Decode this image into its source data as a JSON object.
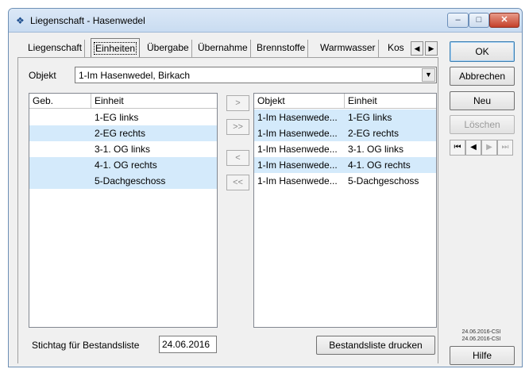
{
  "window": {
    "title": "Liegenschaft - Hasenwedel",
    "controls": {
      "minimize": "–",
      "maximize": "□",
      "close": "✕"
    }
  },
  "tabs": [
    {
      "label": "Liegenschaft",
      "active": false
    },
    {
      "label": "Einheiten",
      "active": true
    },
    {
      "label": "Übergabe",
      "active": false
    },
    {
      "label": "Übernahme",
      "active": false
    },
    {
      "label": "Brennstoffe",
      "active": false
    },
    {
      "label": "Warmwasser",
      "active": false
    },
    {
      "label": "Kos",
      "active": false
    }
  ],
  "objekt": {
    "label": "Objekt",
    "value": "1-Im Hasenwedel, Birkach"
  },
  "left_list": {
    "columns": [
      "Geb.",
      "Einheit"
    ],
    "rows": [
      {
        "geb": "",
        "einheit": "1-EG links"
      },
      {
        "geb": "",
        "einheit": "2-EG rechts"
      },
      {
        "geb": "",
        "einheit": "3-1. OG links"
      },
      {
        "geb": "",
        "einheit": "4-1. OG rechts"
      },
      {
        "geb": "",
        "einheit": "5-Dachgeschoss"
      }
    ]
  },
  "move_buttons": [
    ">",
    ">>",
    "<",
    "<<"
  ],
  "right_list": {
    "columns": [
      "Objekt",
      "Einheit"
    ],
    "rows": [
      {
        "objekt": "1-Im Hasenwede...",
        "einheit": "1-EG links"
      },
      {
        "objekt": "1-Im Hasenwede...",
        "einheit": "2-EG rechts"
      },
      {
        "objekt": "1-Im Hasenwede...",
        "einheit": "3-1. OG links"
      },
      {
        "objekt": "1-Im Hasenwede...",
        "einheit": "4-1. OG rechts"
      },
      {
        "objekt": "1-Im Hasenwede...",
        "einheit": "5-Dachgeschoss"
      }
    ]
  },
  "stichtag": {
    "label": "Stichtag für Bestandsliste",
    "value": "24.06.2016"
  },
  "buttons": {
    "print": "Bestandsliste drucken",
    "ok": "OK",
    "cancel": "Abbrechen",
    "new": "Neu",
    "delete": "Löschen",
    "help": "Hilfe"
  },
  "version_lines": [
    "24.06.2016-CSI",
    "24.06.2016-CSI"
  ]
}
